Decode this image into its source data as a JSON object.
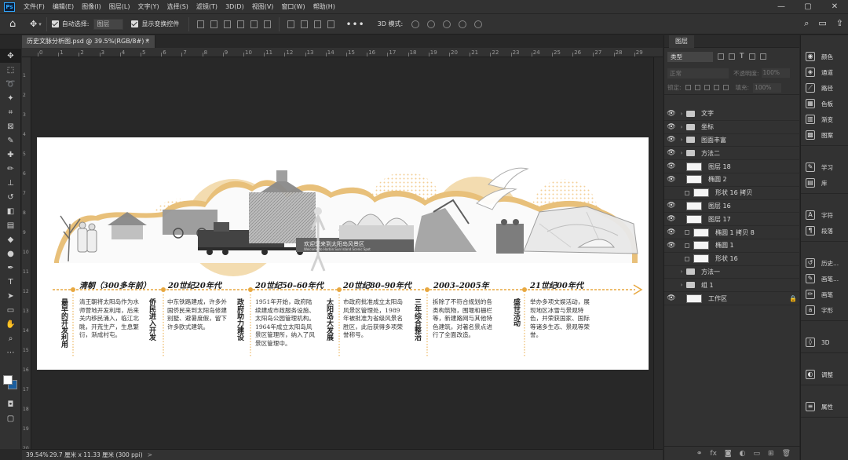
{
  "app": {
    "logo": "Ps"
  },
  "menu": [
    "文件(F)",
    "编辑(E)",
    "图像(I)",
    "图层(L)",
    "文字(Y)",
    "选择(S)",
    "滤镜(T)",
    "3D(D)",
    "视图(V)",
    "窗口(W)",
    "帮助(H)"
  ],
  "options": {
    "auto_select_label": "自动选择:",
    "auto_select_value": "图层",
    "show_transform_label": "显示变换控件",
    "mode_3d_label": "3D 模式:",
    "more": "•••"
  },
  "document": {
    "tab_title": "历史文脉分析图.psd @ 39.5%(RGB/8#) *",
    "close": "×"
  },
  "ruler": {
    "h_ticks": [
      "0",
      "1",
      "2",
      "3",
      "4",
      "5",
      "6",
      "7",
      "8",
      "9",
      "10",
      "11",
      "12",
      "13",
      "14",
      "15",
      "16",
      "17",
      "18",
      "19",
      "20",
      "21",
      "22",
      "23",
      "24",
      "25",
      "26",
      "27",
      "28",
      "29"
    ],
    "v_ticks": [
      "1",
      "2",
      "3",
      "4",
      "5",
      "6",
      "7",
      "8",
      "9",
      "10",
      "11",
      "12",
      "13",
      "14",
      "15",
      "16",
      "17",
      "18",
      "19",
      "20"
    ]
  },
  "status": {
    "zoom": "39.54%",
    "size": "29.7 厘米 x 11.33 厘米 (300 ppi)",
    "arrow": ">"
  },
  "layers_panel": {
    "title": "图层",
    "filter_kind": "类型",
    "blend_mode": "正常",
    "opacity_label": "不透明度:",
    "opacity_value": "100%",
    "lock_label": "锁定:",
    "fill_label": "填充:",
    "fill_value": "100%",
    "layers": [
      {
        "name": "文字",
        "type": "group",
        "visible": true
      },
      {
        "name": "坐标",
        "type": "group",
        "visible": true
      },
      {
        "name": "图面丰富",
        "type": "group",
        "visible": true
      },
      {
        "name": "方法二",
        "type": "group",
        "visible": true
      },
      {
        "name": "图层 18",
        "type": "pixel",
        "visible": true
      },
      {
        "name": "椭圆 2",
        "type": "pixel",
        "visible": true
      },
      {
        "name": "形状 16 拷贝",
        "type": "shape",
        "visible": false
      },
      {
        "name": "图层 16",
        "type": "pixel",
        "visible": true
      },
      {
        "name": "图层 17",
        "type": "pixel",
        "visible": true
      },
      {
        "name": "椭圆 1 拷贝 8",
        "type": "shape",
        "visible": true
      },
      {
        "name": "椭圆 1",
        "type": "shape",
        "visible": true
      },
      {
        "name": "形状 16",
        "type": "shape",
        "visible": false
      },
      {
        "name": "方法一",
        "type": "group",
        "visible": false
      },
      {
        "name": "组 1",
        "type": "group",
        "visible": false
      },
      {
        "name": "工作区",
        "type": "pixel",
        "visible": true,
        "locked": true
      }
    ]
  },
  "dock": {
    "groups": [
      [
        "颜色",
        "通道",
        "路径",
        "色板",
        "渐变",
        "图案"
      ],
      [
        "学习",
        "库"
      ],
      [
        "字符",
        "段落"
      ],
      [
        "历史...",
        "画笔...",
        "画笔",
        "字形"
      ],
      [
        "3D"
      ],
      [
        "调整"
      ],
      [
        "属性"
      ]
    ]
  },
  "poster": {
    "sign_cn": "欢迎您来到太阳岛风景区",
    "sign_en": "Welcome to Harbin Sun Island Scenic Spot",
    "eras": [
      {
        "era": "清朝（300多年前）",
        "titles": [
          "最早的开发利用"
        ],
        "desc": "清王朝将太阳岛作为水师营地开发利用，后来关内移民涌入，临江北眺，开荒生产，生息繁衍，渐成村屯。"
      },
      {
        "era": "20世纪20年代",
        "titles": [
          "侨民进入开发"
        ],
        "desc": "中东铁路建成，许多外国侨民来到太阳岛修建别墅、避暑度假，留下许多欧式建筑。"
      },
      {
        "era": "20世纪50–60年代",
        "titles": [
          "政府助力建设"
        ],
        "desc": "1951年开始，政府陆续建成市政服务设施、太阳岛公园管理机构。1964年成立太阳岛风景区管理所，纳入了风景区管理中。"
      },
      {
        "era": "20世纪80–90年代",
        "titles": [
          "太阳岛大发展"
        ],
        "desc": "市政府批准成立太阳岛风景区管理处，1989年被批准为省级风景名胜区，此后获得多项荣誉称号。"
      },
      {
        "era": "2003–2005年",
        "titles": [
          "三年综合整治"
        ],
        "desc": "拆除了不符合规划的各类构筑物，围堰和栅栏等，新建路网与其他特色建筑，对著名景点进行了全面改造。"
      },
      {
        "era": "21世纪00年代",
        "titles": [
          "盛世活动"
        ],
        "desc": "举办多项文娱活动，展现地区冰雪与景观特色，并荣获国家、国际等诸多生态、景观等荣誉。"
      }
    ]
  },
  "colors": {
    "accent": "#e8a840",
    "ps_blue": "#31a8ff",
    "bg": "#282828",
    "panel": "#323232"
  }
}
